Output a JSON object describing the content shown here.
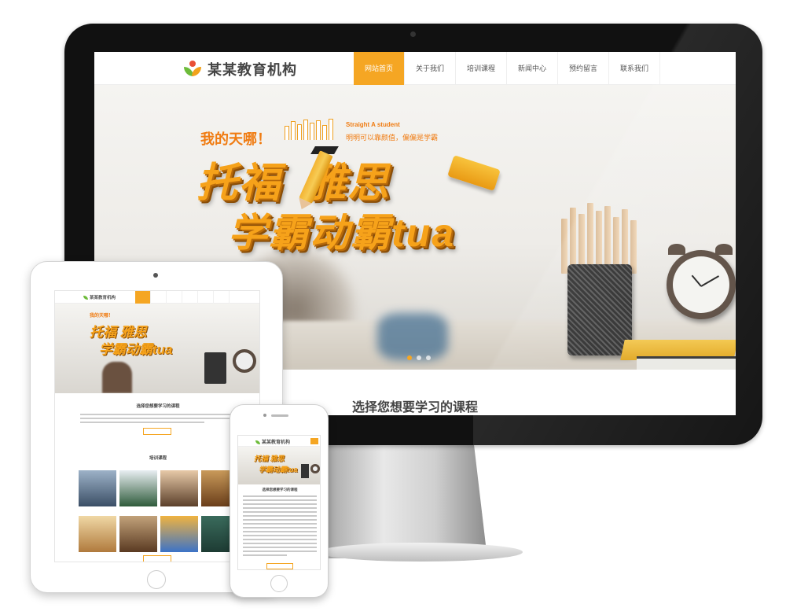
{
  "site": {
    "name": "某某教育机构",
    "nav": [
      "网站首页",
      "关于我们",
      "培训课程",
      "新闻中心",
      "预约留言",
      "联系我们"
    ],
    "active_nav": "网站首页"
  },
  "hero": {
    "exclaim": "我的天哪！",
    "tag_en": "Straight A student",
    "tag_cn": "明明可以靠颜值，偏偏是学霸",
    "headline1": "托福",
    "headline1b": "雅思",
    "headline2": "学霸动霸tua"
  },
  "sections": {
    "choose_course": "选择您想要学习的课程",
    "courses": "培训课程"
  },
  "colors": {
    "accent": "#f5a623",
    "headline": "#f6a21a",
    "logo_green": "#6dbb3a",
    "logo_orange": "#f2a21b"
  }
}
